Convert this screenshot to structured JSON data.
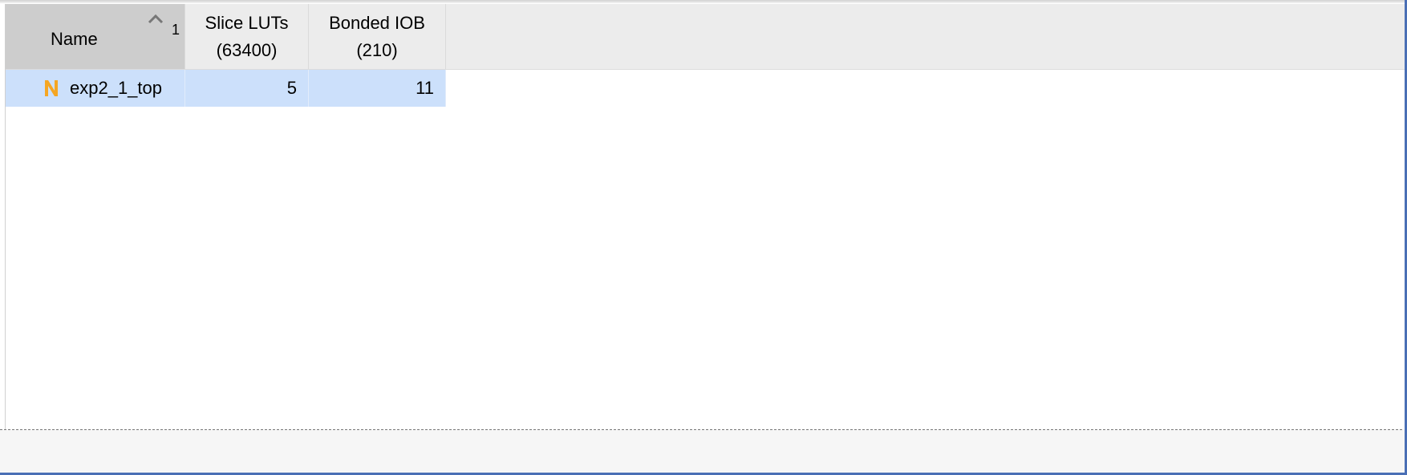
{
  "table": {
    "columns": [
      {
        "label_line1": "Name",
        "label_line2": ""
      },
      {
        "label_line1": "Slice LUTs",
        "label_line2": "(63400)"
      },
      {
        "label_line1": "Bonded IOB",
        "label_line2": "(210)"
      }
    ],
    "sort": {
      "column": "Name",
      "direction": "ascending",
      "order": "1",
      "icon": "chevron-up-icon"
    },
    "rows": [
      {
        "icon": "net-n-icon",
        "name": "exp2_1_top",
        "slice_luts": "5",
        "bonded_iob": "11"
      }
    ]
  },
  "colors": {
    "selected_row": "#cce0fb",
    "sorted_header": "#cdcdcd",
    "header": "#ececec",
    "net_icon": "#f5a623",
    "frame_border": "#4a6fb5"
  }
}
